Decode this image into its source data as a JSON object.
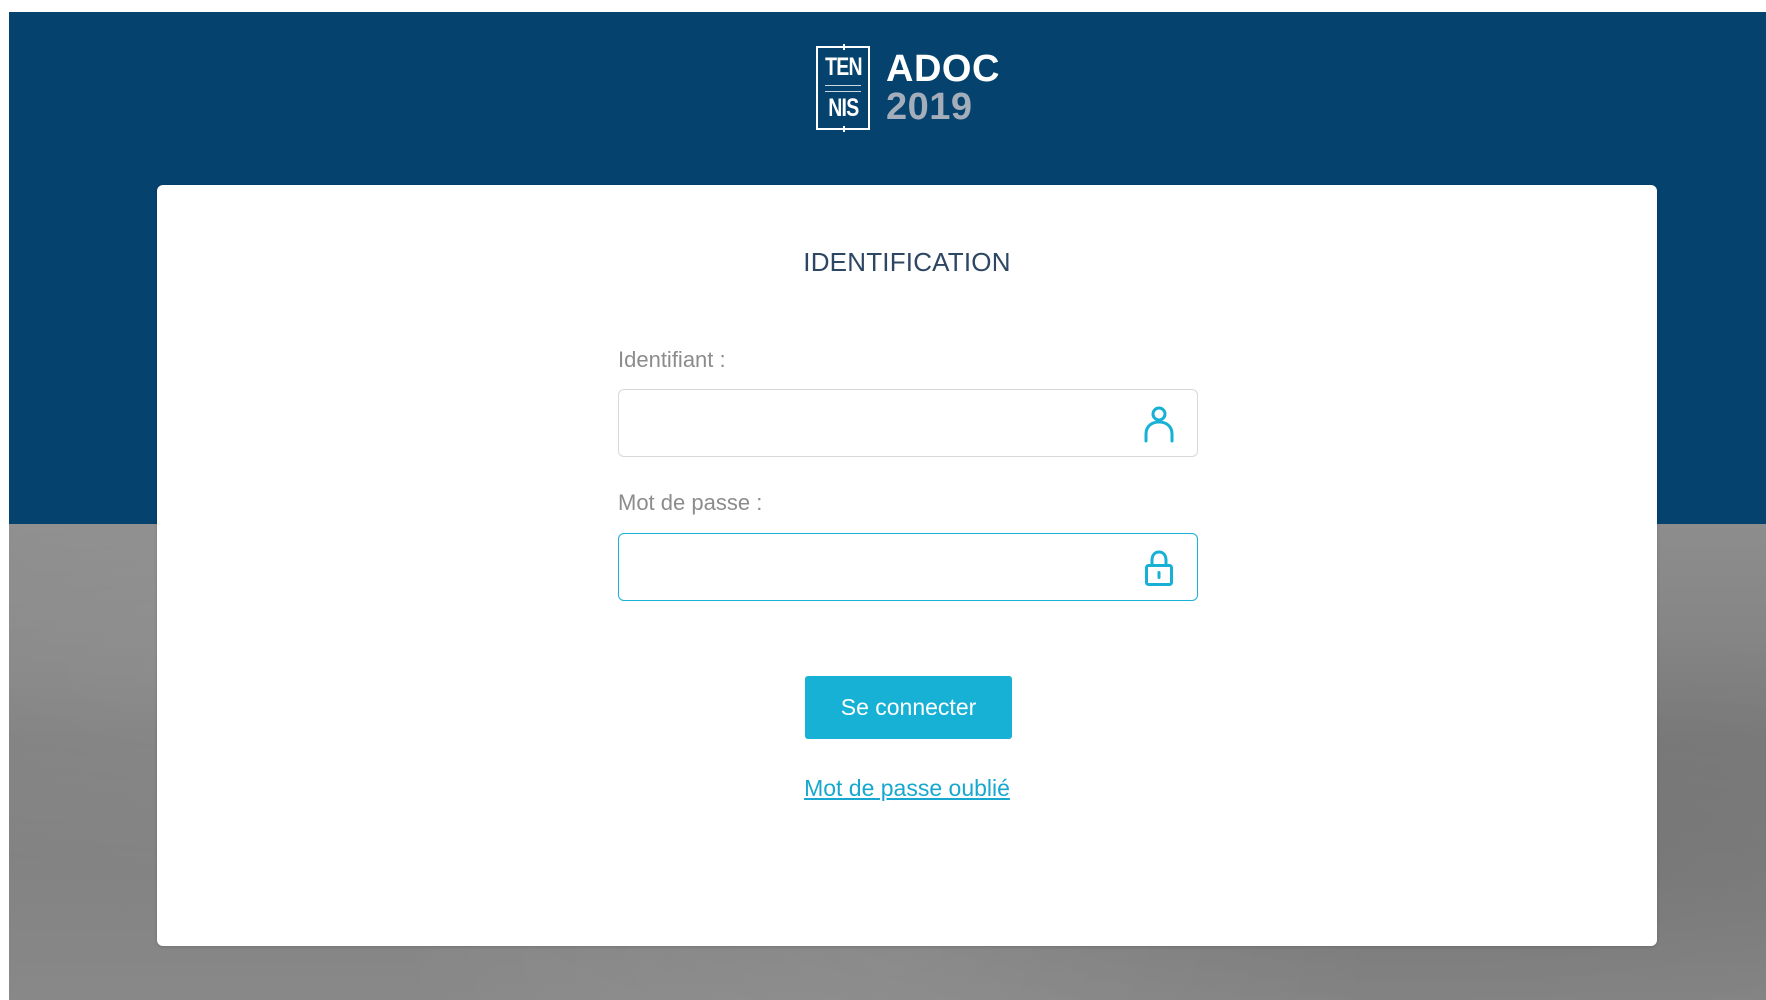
{
  "brand": {
    "logo_line1": "TEN",
    "logo_line2": "NIS",
    "app_name": "ADOC",
    "year": "2019",
    "header_color": "#05426e",
    "accent_color": "#17b1d6"
  },
  "login": {
    "title": "IDENTIFICATION",
    "username_label": "Identifiant :",
    "username_value": "",
    "username_icon": "user-icon",
    "password_label": "Mot de passe :",
    "password_value": "",
    "password_icon": "lock-icon",
    "submit_label": "Se connecter",
    "forgot_label": "Mot de passe oublié"
  }
}
